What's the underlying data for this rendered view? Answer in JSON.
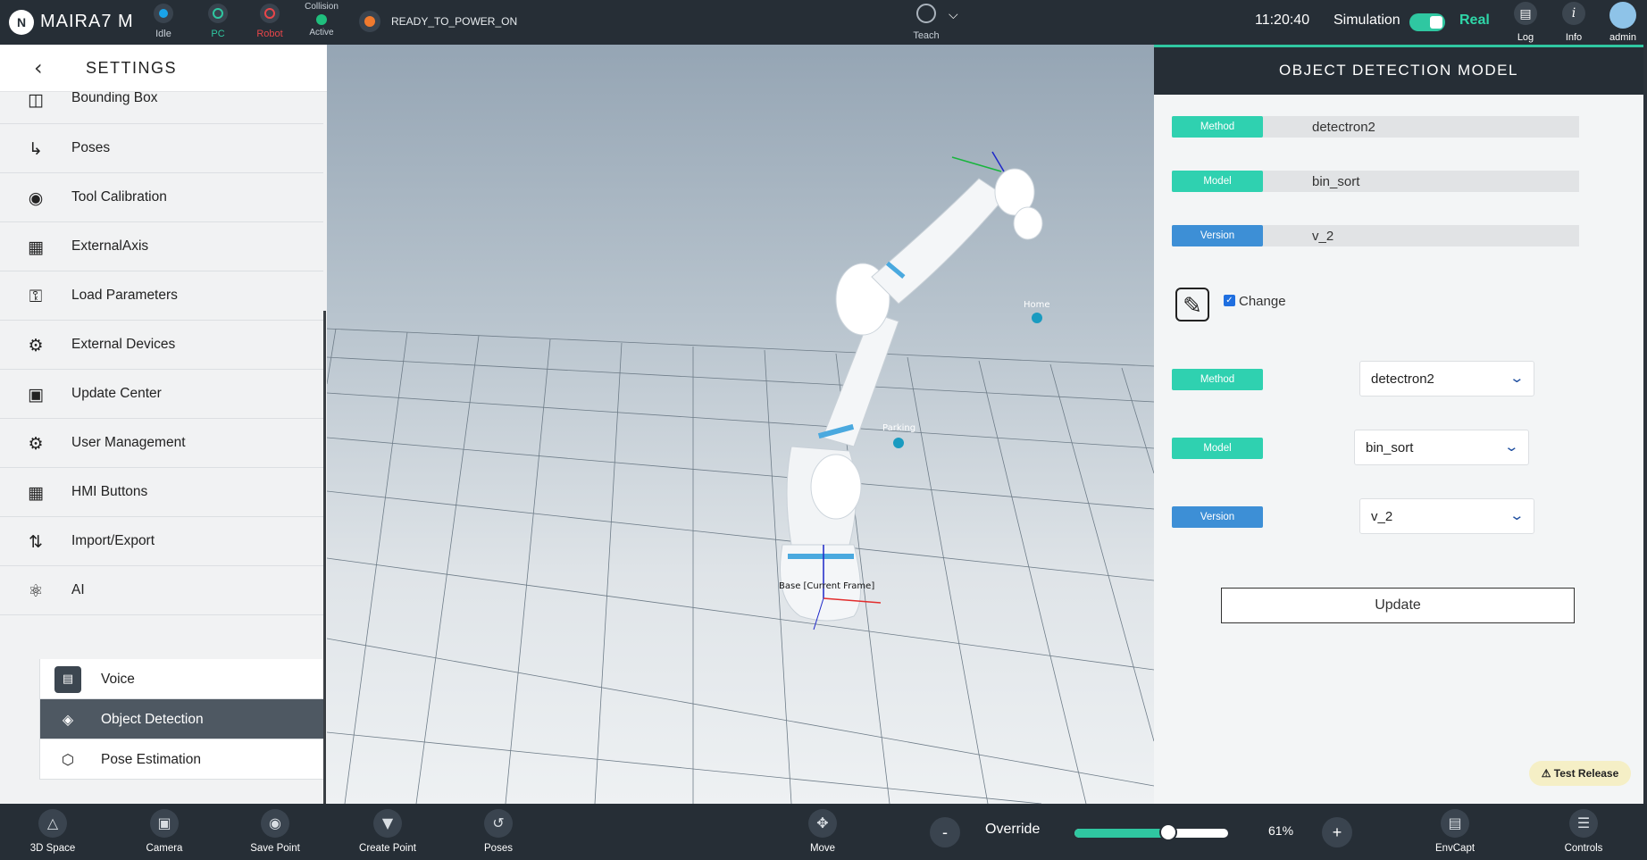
{
  "topbar": {
    "brand": "MAIRA7 M",
    "logo": "N",
    "status": {
      "idle": {
        "label": "Idle",
        "color": "#1aa3e8"
      },
      "pc": {
        "label": "PC",
        "color": "#2fc7a1"
      },
      "robot": {
        "label": "Robot",
        "color": "#e8464a"
      },
      "collision": {
        "top": "Collision",
        "label": "Active",
        "color": "#1fbf7d"
      }
    },
    "state": "READY_TO_POWER_ON",
    "teach": "Teach",
    "time": "11:20:40",
    "simulation": "Simulation",
    "real": "Real",
    "log": "Log",
    "info": "Info",
    "user": "admin"
  },
  "sidebar": {
    "title": "SETTINGS",
    "items": [
      {
        "label": "Bounding Box",
        "icon": "bounding-box-icon"
      },
      {
        "label": "Poses",
        "icon": "poses-icon"
      },
      {
        "label": "Tool Calibration",
        "icon": "tool-calibration-icon"
      },
      {
        "label": "ExternalAxis",
        "icon": "external-axis-icon"
      },
      {
        "label": "Load Parameters",
        "icon": "load-parameters-icon"
      },
      {
        "label": "External Devices",
        "icon": "external-devices-icon"
      },
      {
        "label": "Update Center",
        "icon": "update-center-icon"
      },
      {
        "label": "User Management",
        "icon": "user-management-icon"
      },
      {
        "label": "HMI Buttons",
        "icon": "hmi-buttons-icon"
      },
      {
        "label": "Import/Export",
        "icon": "import-export-icon"
      },
      {
        "label": "AI",
        "icon": "ai-icon"
      }
    ],
    "sub_items": [
      {
        "label": "Voice",
        "icon": "voice-icon"
      },
      {
        "label": "Object Detection",
        "icon": "layers-icon"
      },
      {
        "label": "Pose Estimation",
        "icon": "cube-icon"
      }
    ]
  },
  "viewport": {
    "labels": {
      "home": "Home",
      "parking": "Parking",
      "base": "Base [Current Frame]"
    }
  },
  "panel": {
    "title": "OBJECT DETECTION MODEL",
    "current": {
      "method_tag": "Method",
      "method": "detectron2",
      "model_tag": "Model",
      "model": "bin_sort",
      "version_tag": "Version",
      "version": "v_2"
    },
    "change_label": "Change",
    "change_checked": true,
    "edit": {
      "method_tag": "Method",
      "method": "detectron2",
      "model_tag": "Model",
      "model": "bin_sort",
      "version_tag": "Version",
      "version": "v_2"
    },
    "update": "Update",
    "test_release": "Test Release"
  },
  "bottombar": {
    "space3d": "3D Space",
    "camera": "Camera",
    "save_point": "Save Point",
    "create_point": "Create Point",
    "poses": "Poses",
    "move": "Move",
    "minus": "-",
    "override": "Override",
    "override_value": 61,
    "override_text": "61%",
    "plus": "+",
    "envcapt": "EnvCapt",
    "controls": "Controls"
  },
  "colors": {
    "accent": "#2fc7a1",
    "tag_blue": "#3d8fd6",
    "orange_state": "#f07a2e"
  }
}
